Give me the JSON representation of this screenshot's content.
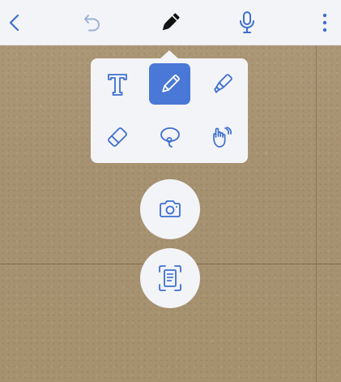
{
  "colors": {
    "accent": "#4a78d6",
    "icon_blue": "#3d6fcf",
    "icon_gray": "#9cb2d8",
    "toolbar_bg": "#f3f4f8",
    "paper": "#a99574"
  },
  "toolbar": {
    "back_icon": "chevron-left-icon",
    "undo_icon": "undo-icon",
    "pencil_icon": "pencil-icon",
    "mic_icon": "microphone-icon",
    "more_icon": "more-vertical-icon"
  },
  "tools": {
    "selected": "pen",
    "items": [
      {
        "id": "text",
        "icon": "text-icon"
      },
      {
        "id": "pen",
        "icon": "pen-icon"
      },
      {
        "id": "highlighter",
        "icon": "highlighter-icon"
      },
      {
        "id": "eraser",
        "icon": "eraser-icon"
      },
      {
        "id": "lasso",
        "icon": "lasso-icon"
      },
      {
        "id": "hand",
        "icon": "hand-icon"
      }
    ]
  },
  "actions": [
    {
      "id": "camera",
      "icon": "camera-icon"
    },
    {
      "id": "scan",
      "icon": "scan-document-icon"
    }
  ]
}
